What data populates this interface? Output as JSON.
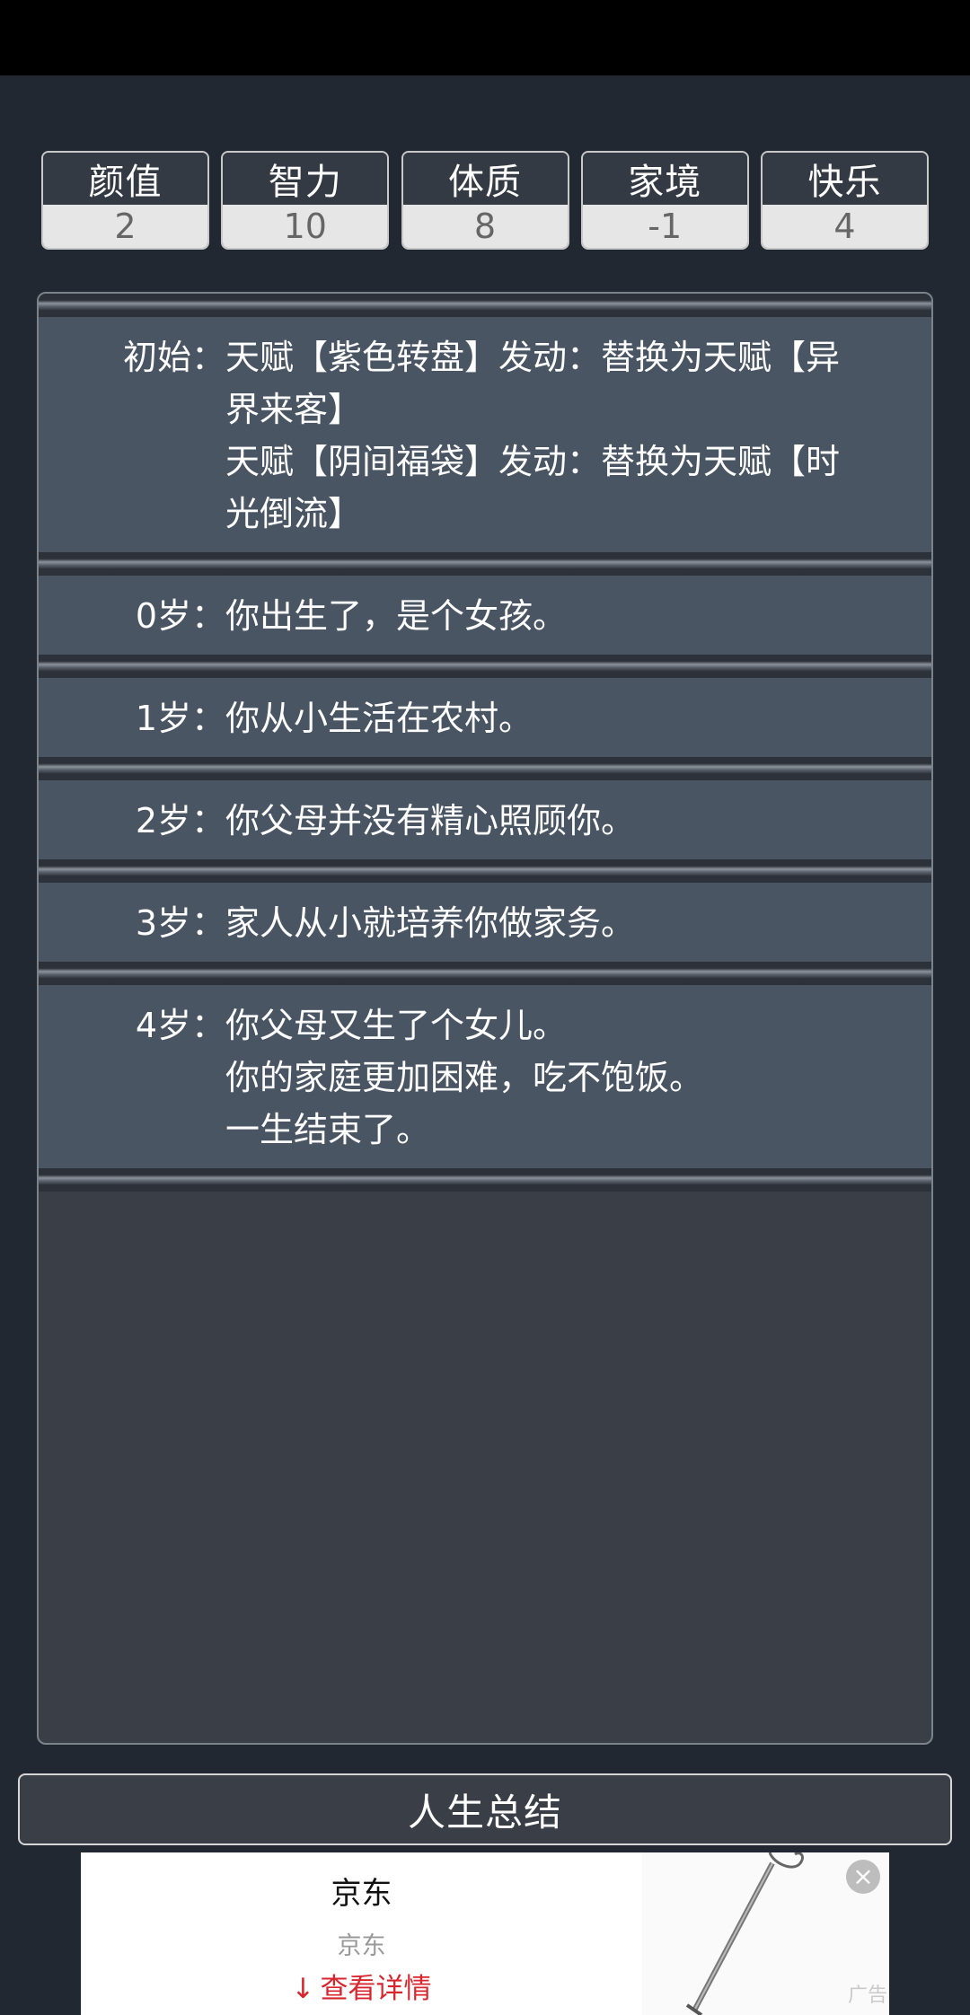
{
  "stats": [
    {
      "label": "颜值",
      "value": "2"
    },
    {
      "label": "智力",
      "value": "10"
    },
    {
      "label": "体质",
      "value": "8"
    },
    {
      "label": "家境",
      "value": "-1"
    },
    {
      "label": "快乐",
      "value": "4"
    }
  ],
  "entries": [
    {
      "age": "初始：",
      "lines": [
        "天赋【紫色转盘】发动：替换为天赋【异界来客】",
        "天赋【阴间福袋】发动：替换为天赋【时光倒流】"
      ]
    },
    {
      "age": "0岁：",
      "lines": [
        "你出生了，是个女孩。"
      ]
    },
    {
      "age": "1岁：",
      "lines": [
        "你从小生活在农村。"
      ]
    },
    {
      "age": "2岁：",
      "lines": [
        "你父母并没有精心照顾你。"
      ]
    },
    {
      "age": "3岁：",
      "lines": [
        "家人从小就培养你做家务。"
      ]
    },
    {
      "age": "4岁：",
      "lines": [
        "你父母又生了个女儿。",
        "你的家庭更加困难，吃不饱饭。",
        "一生结束了。"
      ]
    }
  ],
  "summary_button": "人生总结",
  "ad": {
    "title": "京东",
    "subtitle": "京东",
    "cta": "查看详情",
    "tag": "广告",
    "close_icon": "×",
    "arrow_icon": "↓"
  }
}
